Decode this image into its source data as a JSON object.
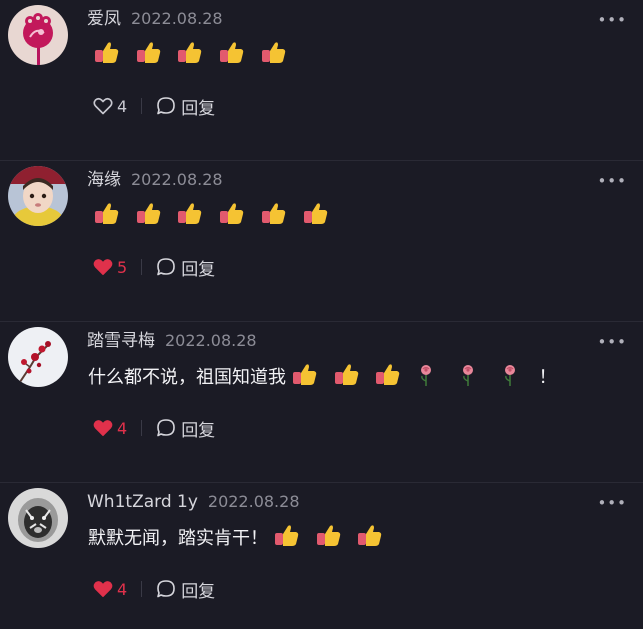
{
  "colors": {
    "background": "#1b1b25",
    "liked": "#e0314b",
    "muted": "#8c8c96"
  },
  "comments": [
    {
      "username": "爱凤",
      "date": "2022.08.28",
      "text": "",
      "emoji": [
        "thumbs-up",
        "thumbs-up",
        "thumbs-up",
        "thumbs-up",
        "thumbs-up"
      ],
      "tail": "",
      "likes": "4",
      "liked": false,
      "reply_label": "回复",
      "avatar": "pink-flower-avatar"
    },
    {
      "username": "海缘",
      "date": "2022.08.28",
      "text": "",
      "emoji": [
        "thumbs-up",
        "thumbs-up",
        "thumbs-up",
        "thumbs-up",
        "thumbs-up",
        "thumbs-up"
      ],
      "tail": "",
      "likes": "5",
      "liked": true,
      "reply_label": "回复",
      "avatar": "baby-photo-avatar"
    },
    {
      "username": "踏雪寻梅",
      "date": "2022.08.28",
      "text": "什么都不说，祖国知道我",
      "emoji": [
        "thumbs-up",
        "thumbs-up",
        "thumbs-up",
        "rose",
        "rose",
        "rose"
      ],
      "tail": "！",
      "likes": "4",
      "liked": true,
      "reply_label": "回复",
      "avatar": "plum-blossom-avatar"
    },
    {
      "username": "Wh1tZard 1y",
      "date": "2022.08.28",
      "text": "默默无闻，踏实肯干！",
      "emoji": [
        "thumbs-up",
        "thumbs-up",
        "thumbs-up"
      ],
      "tail": "",
      "likes": "4",
      "liked": true,
      "reply_label": "回复",
      "avatar": "tiger-photo-avatar"
    }
  ],
  "more_icon": "more-icon"
}
